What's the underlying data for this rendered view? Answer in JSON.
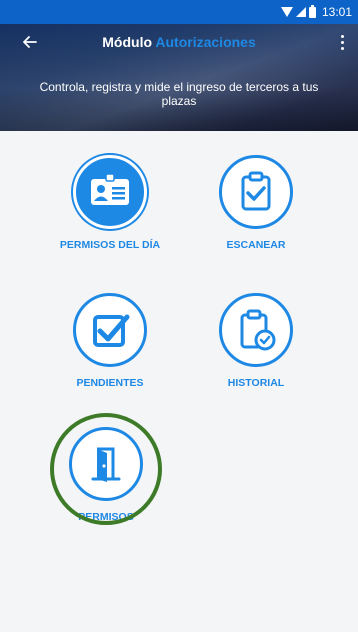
{
  "status_bar": {
    "time": "13:01",
    "icons": [
      "wifi-icon",
      "signal-icon",
      "battery-icon"
    ]
  },
  "header": {
    "title_main": "Módulo",
    "title_accent": "Autorizaciones",
    "subtitle": "Controla, registra y mide el ingreso de terceros a tus plazas"
  },
  "tiles": [
    {
      "label": "PERMISOS DEL DÍA",
      "icon": "id-card-icon"
    },
    {
      "label": "ESCANEAR",
      "icon": "clipboard-check-icon"
    },
    {
      "label": "PENDIENTES",
      "icon": "checkbox-icon"
    },
    {
      "label": "HISTORIAL",
      "icon": "clipboard-history-icon"
    },
    {
      "label": "PERMISOS",
      "icon": "door-icon"
    }
  ],
  "colors": {
    "primary": "#1e88e5",
    "status_bar": "#0d63c7",
    "highlight": "#3e7b29"
  }
}
